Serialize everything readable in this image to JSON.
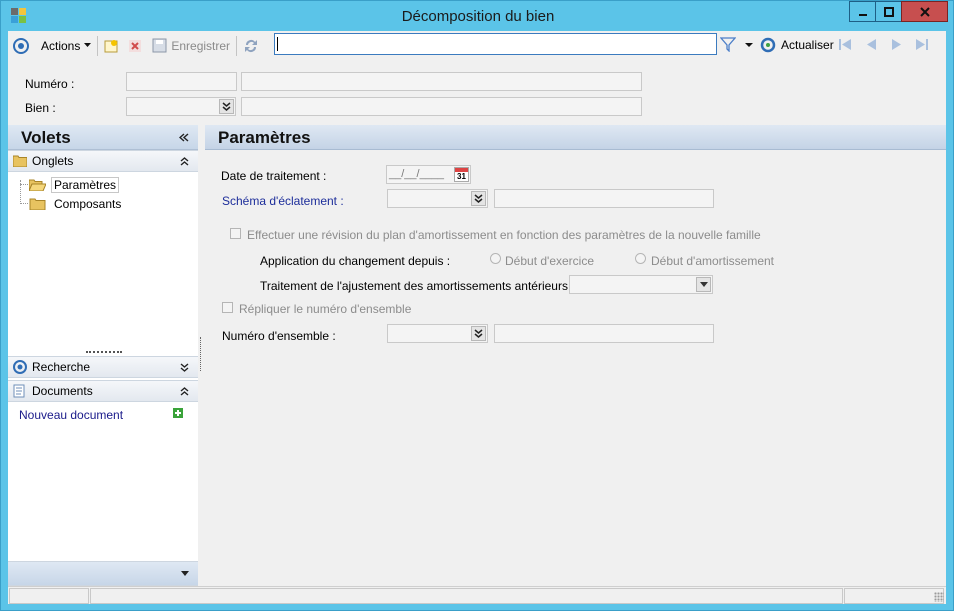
{
  "window": {
    "title": "Décomposition du bien"
  },
  "toolbar": {
    "actions_label": "Actions",
    "save_label": "Enregistrer",
    "search_value": "",
    "refresh_label": "Actualiser"
  },
  "header": {
    "numero_label": "Numéro :",
    "bien_label": "Bien :"
  },
  "volets": {
    "title": "Volets",
    "onglets_label": "Onglets",
    "tree": [
      {
        "label": "Paramètres"
      },
      {
        "label": "Composants"
      }
    ],
    "recherche_label": "Recherche",
    "documents_label": "Documents",
    "new_document_label": "Nouveau document"
  },
  "params": {
    "title": "Paramètres",
    "date_label": "Date de traitement :",
    "date_placeholder": "__/__/____",
    "calendar_day": "31",
    "schema_label": "Schéma d'éclatement :",
    "revision_label": "Effectuer une révision du plan d'amortissement en fonction des paramètres de la nouvelle famille",
    "application_label": "Application du changement depuis :",
    "radio_exercice": "Début d'exercice",
    "radio_amortissement": "Début d'amortissement",
    "traitement_label": "Traitement de l'ajustement des amortissements antérieurs :",
    "repliquer_label": "Répliquer le numéro d'ensemble",
    "numero_ensemble_label": "Numéro d'ensemble :"
  }
}
